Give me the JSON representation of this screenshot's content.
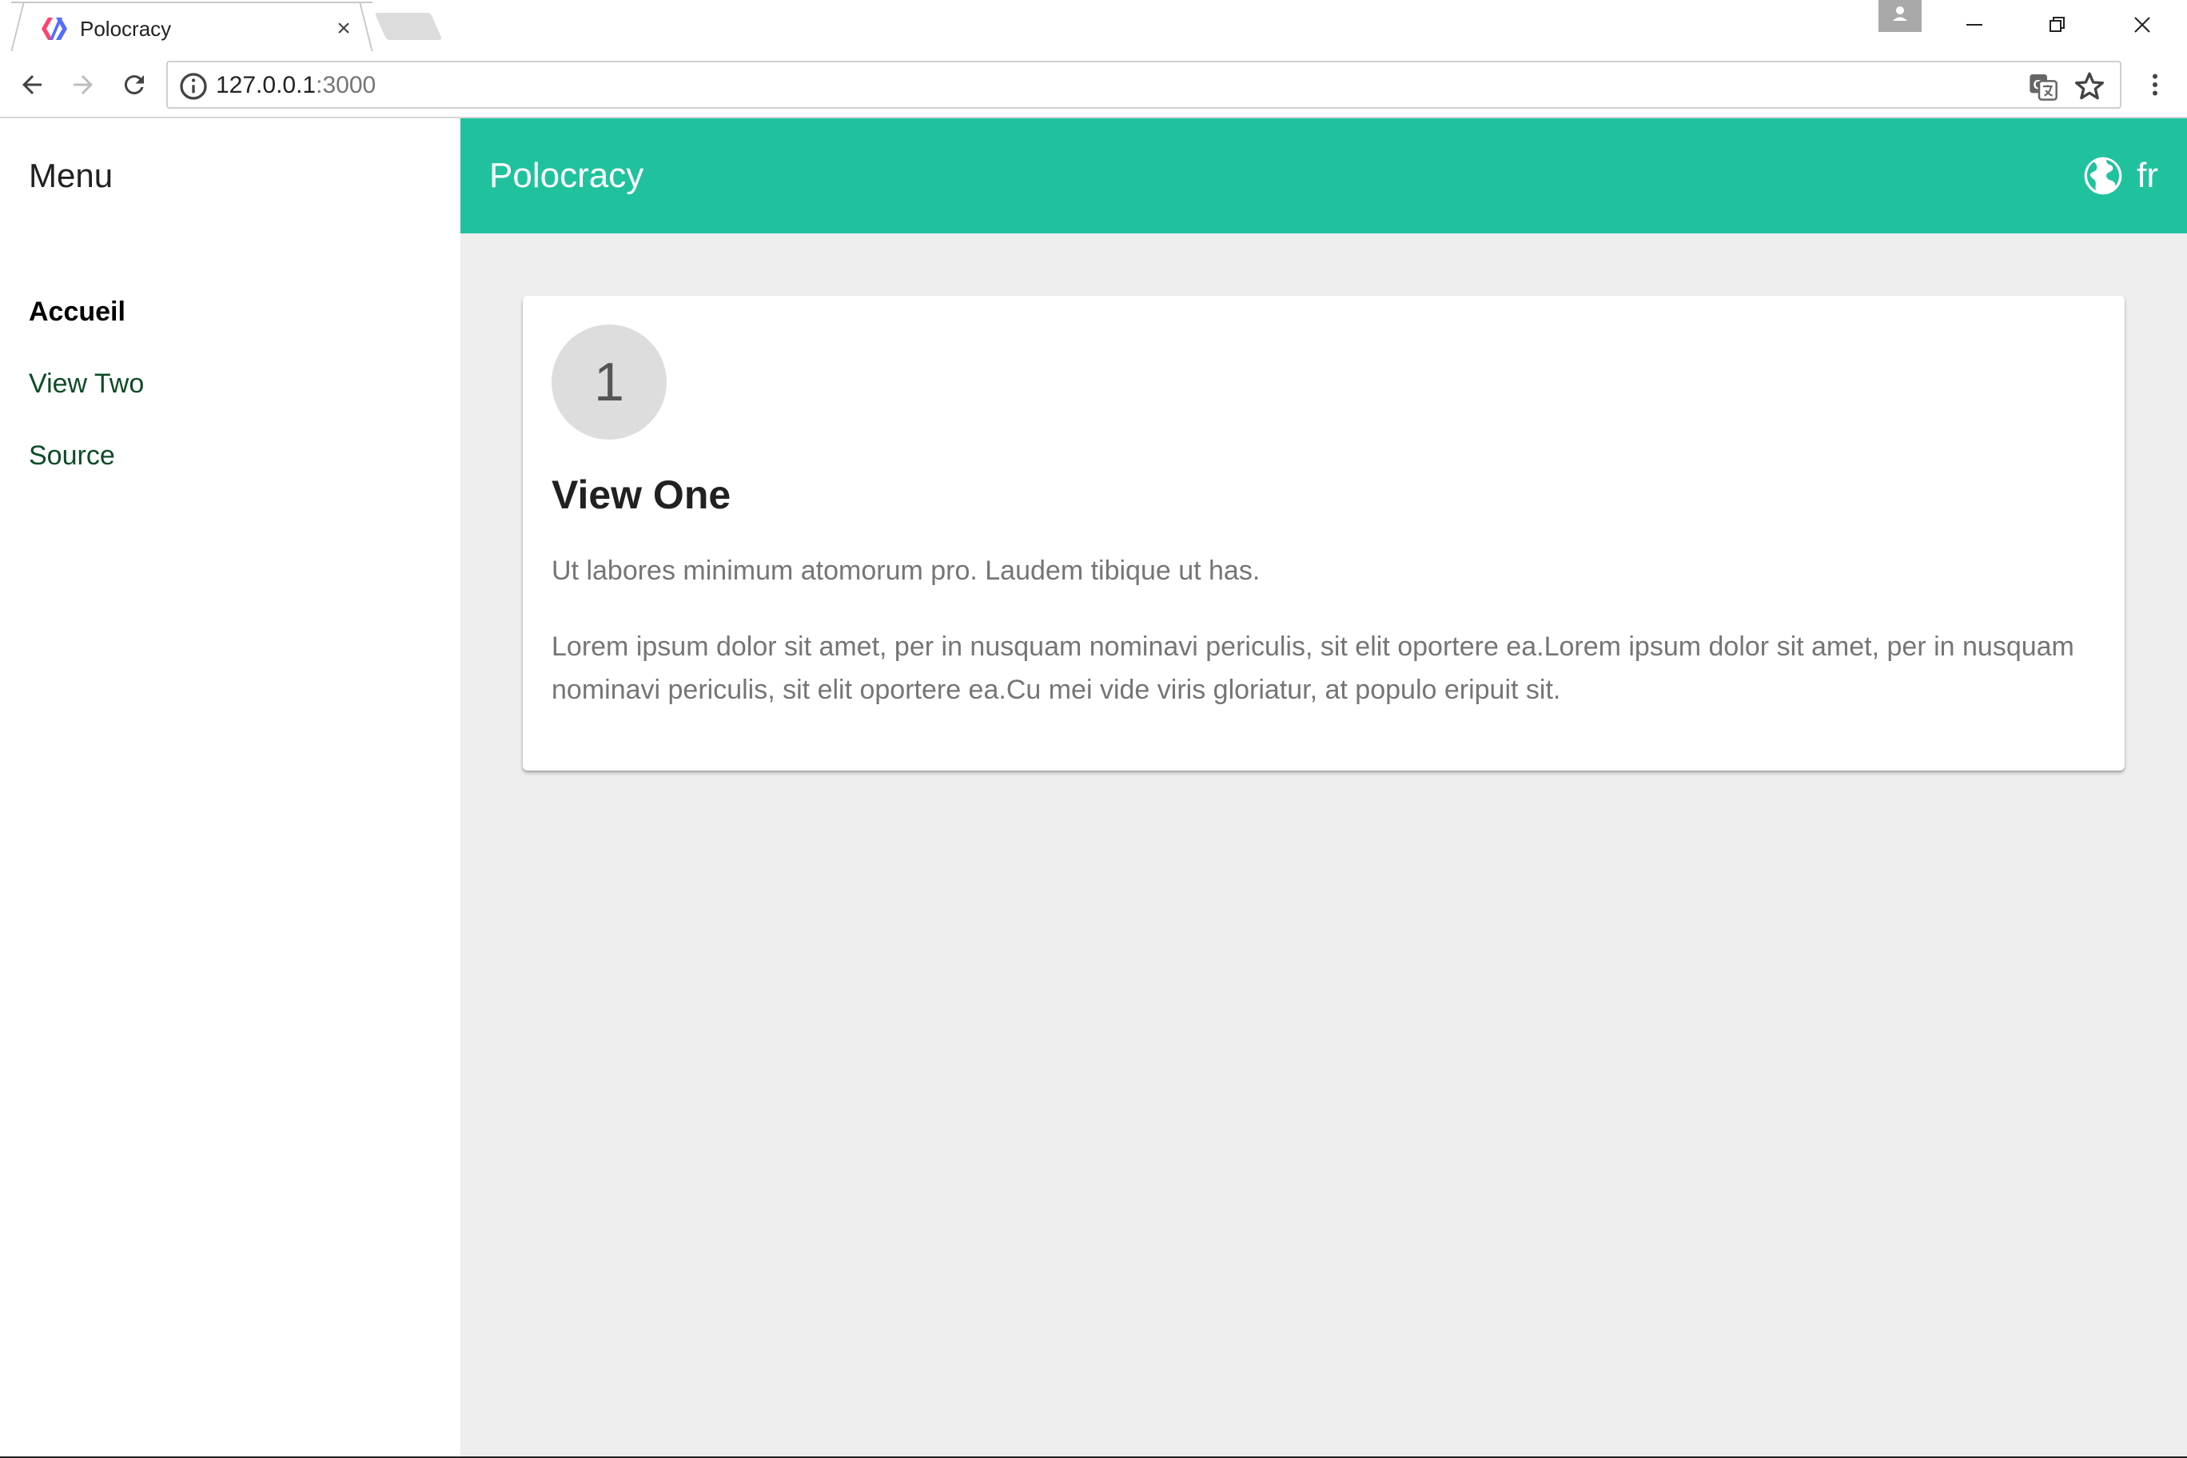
{
  "browser": {
    "tab_title": "Polocracy",
    "url_host": "127.0.0.1",
    "url_port": ":3000"
  },
  "sidebar": {
    "title": "Menu",
    "items": [
      {
        "label": "Accueil",
        "active": true
      },
      {
        "label": "View Two",
        "active": false
      },
      {
        "label": "Source",
        "active": false
      }
    ]
  },
  "appbar": {
    "title": "Polocracy",
    "language": "fr"
  },
  "card": {
    "number": "1",
    "title": "View One",
    "paragraph1": "Ut labores minimum atomorum pro. Laudem tibique ut has.",
    "paragraph2": "Lorem ipsum dolor sit amet, per in nusquam nominavi periculis, sit elit oportere ea.Lorem ipsum dolor sit amet, per in nusquam nominavi periculis, sit elit oportere ea.Cu mei vide viris gloriatur, at populo eripuit sit."
  },
  "colors": {
    "accent": "#20c29e",
    "page_background": "#eeeeee",
    "nav_link": "#0d4b26"
  }
}
